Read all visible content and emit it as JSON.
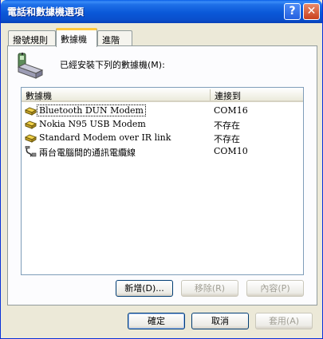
{
  "window": {
    "title": "電話和數據機選項"
  },
  "titlebar": {
    "help_glyph": "?",
    "close_glyph": "✕"
  },
  "tabs": [
    {
      "label": "撥號規則"
    },
    {
      "label": "數據機"
    },
    {
      "label": "進階"
    }
  ],
  "intro_text": "已經安裝下列的數據機(M):",
  "table": {
    "columns": [
      "數據機",
      "連接到"
    ],
    "rows": [
      {
        "name": "Bluetooth DUN Modem",
        "port": "COM16",
        "icon": "modem-icon"
      },
      {
        "name": "Nokia N95 USB Modem",
        "port": "不存在",
        "icon": "modem-icon"
      },
      {
        "name": "Standard Modem over IR link",
        "port": "不存在",
        "icon": "modem-icon"
      },
      {
        "name": "兩台電腦間的通訊電纜線",
        "port": "COM10",
        "icon": "cable-icon"
      }
    ]
  },
  "panel_buttons": {
    "add": "新增(D)...",
    "remove": "移除(R)",
    "properties": "內容(P)"
  },
  "dialog_buttons": {
    "ok": "確定",
    "cancel": "取消",
    "apply": "套用(A)"
  }
}
